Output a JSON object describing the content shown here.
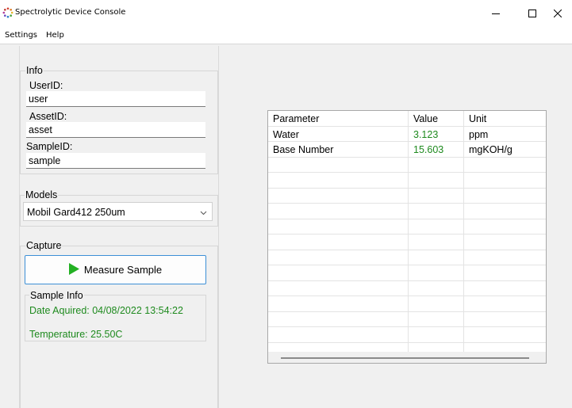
{
  "window": {
    "title": "Spectrolytic Device Console",
    "icon": "spinner-icon",
    "controls": {
      "minimize": "—",
      "maximize": "☐",
      "close": "✕"
    }
  },
  "menu": {
    "settings": "Settings",
    "help": "Help"
  },
  "info": {
    "legend": "Info",
    "user_label": "UserID:",
    "user_value": "user",
    "asset_label": "AssetID:",
    "asset_value": "asset",
    "sample_label": "SampleID:",
    "sample_value": "sample"
  },
  "models": {
    "legend": "Models",
    "selected": "Mobil Gard412 250um"
  },
  "capture": {
    "legend": "Capture",
    "measure_label": "Measure Sample",
    "sample_info": {
      "legend": "Sample Info",
      "date": "Date Aquired: 04/08/2022 13:54:22",
      "temperature": "Temperature: 25.50C"
    }
  },
  "results": {
    "columns": [
      "Parameter",
      "Value",
      "Unit"
    ],
    "rows": [
      {
        "parameter": "Water",
        "value": "3.123",
        "unit": "ppm"
      },
      {
        "parameter": "Base Number",
        "value": "15.603",
        "unit": "mgKOH/g"
      }
    ]
  },
  "colors": {
    "accent": "#3c8fd6",
    "success_text": "#1e8a1e",
    "play_icon": "#22b022"
  }
}
